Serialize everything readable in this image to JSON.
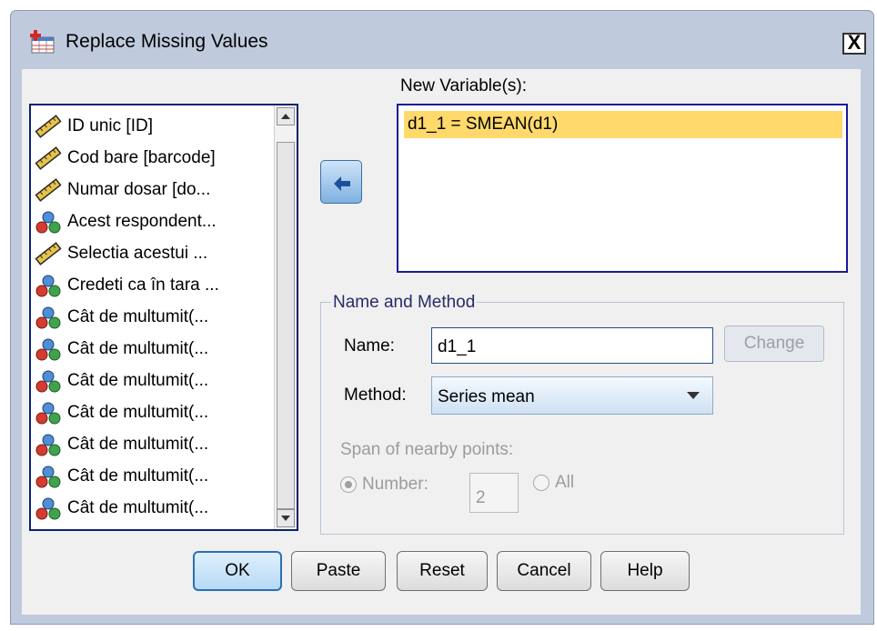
{
  "window": {
    "title": "Replace Missing Values",
    "close_label": "X",
    "app_icon": "table-plus-icon"
  },
  "variables": {
    "items": [
      {
        "label": "ID unic [ID]",
        "icon": "ruler-icon"
      },
      {
        "label": "Cod bare [barcode]",
        "icon": "ruler-icon"
      },
      {
        "label": "Numar dosar [do...",
        "icon": "ruler-icon"
      },
      {
        "label": "Acest respondent...",
        "icon": "nominal-icon"
      },
      {
        "label": "Selectia acestui ...",
        "icon": "ruler-icon"
      },
      {
        "label": "Credeti ca în tara ...",
        "icon": "nominal-icon"
      },
      {
        "label": "Cât de multumit(...",
        "icon": "nominal-icon"
      },
      {
        "label": "Cât de multumit(...",
        "icon": "nominal-icon"
      },
      {
        "label": "Cât de multumit(...",
        "icon": "nominal-icon"
      },
      {
        "label": "Cât de multumit(...",
        "icon": "nominal-icon"
      },
      {
        "label": "Cât de multumit(...",
        "icon": "nominal-icon"
      },
      {
        "label": "Cât de multumit(...",
        "icon": "nominal-icon"
      },
      {
        "label": "Cât de multumit(...",
        "icon": "nominal-icon"
      }
    ]
  },
  "new_variables": {
    "label": "New Variable(s):",
    "items": [
      "d1_1 = SMEAN(d1)"
    ]
  },
  "name_method": {
    "legend": "Name and Method",
    "name_label": "Name:",
    "name_value": "d1_1",
    "change_label": "Change",
    "method_label": "Method:",
    "method_value": "Series mean",
    "span_label": "Span of nearby points:",
    "number_label": "Number:",
    "number_value": "2",
    "all_label": "All"
  },
  "buttons": {
    "ok": "OK",
    "paste": "Paste",
    "reset": "Reset",
    "cancel": "Cancel",
    "help": "Help"
  },
  "colors": {
    "selected_item": "#ffd96b",
    "accent_border": "#1a1a9a"
  }
}
